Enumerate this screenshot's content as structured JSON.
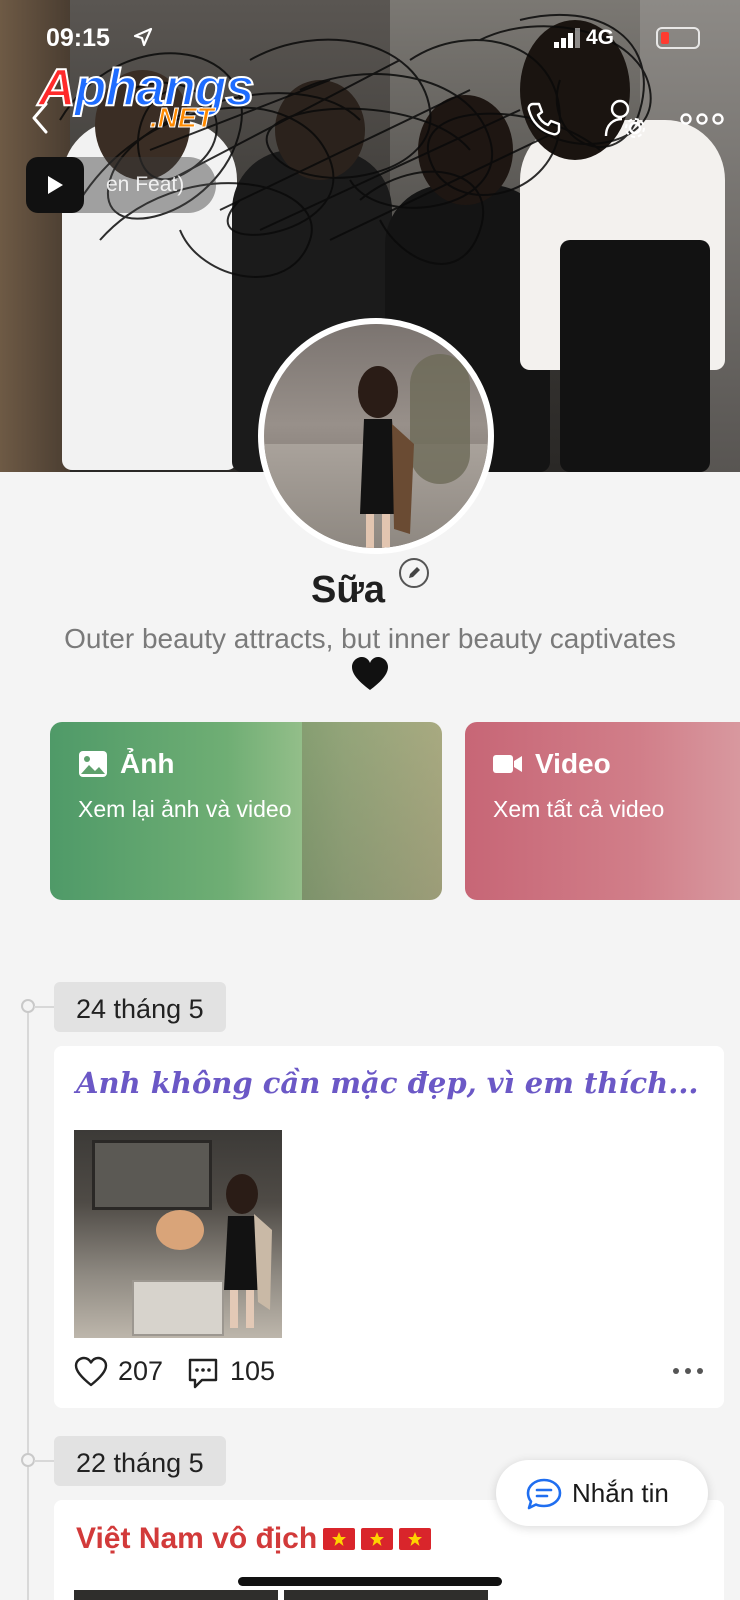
{
  "status_bar": {
    "time": "09:15",
    "network": "4G"
  },
  "watermark": {
    "line1_r": "A",
    "line1_rest": "phangs",
    "line2": ".NET"
  },
  "header": {
    "music": "en Feat)"
  },
  "profile": {
    "name": "Sữa",
    "bio": "Outer beauty attracts, but inner beauty captivates"
  },
  "cards": [
    {
      "title": "Ảnh",
      "subtitle": "Xem lại ảnh và video",
      "color": "#5ea06c"
    },
    {
      "title": "Video",
      "subtitle": "Xem tất cả video",
      "color": "#cf7281"
    }
  ],
  "timeline": [
    {
      "date": "24 tháng 5",
      "caption": "Anh không cần mặc đẹp, vì em thích...",
      "likes": "207",
      "comments": "105"
    },
    {
      "date": "22 tháng 5",
      "caption": "Việt Nam vô địch"
    }
  ],
  "message_button": "Nhắn tin",
  "colors": {
    "caption_purple": "#6b58c6",
    "caption_red": "#d23a3a",
    "background": "#f4f4f4"
  }
}
